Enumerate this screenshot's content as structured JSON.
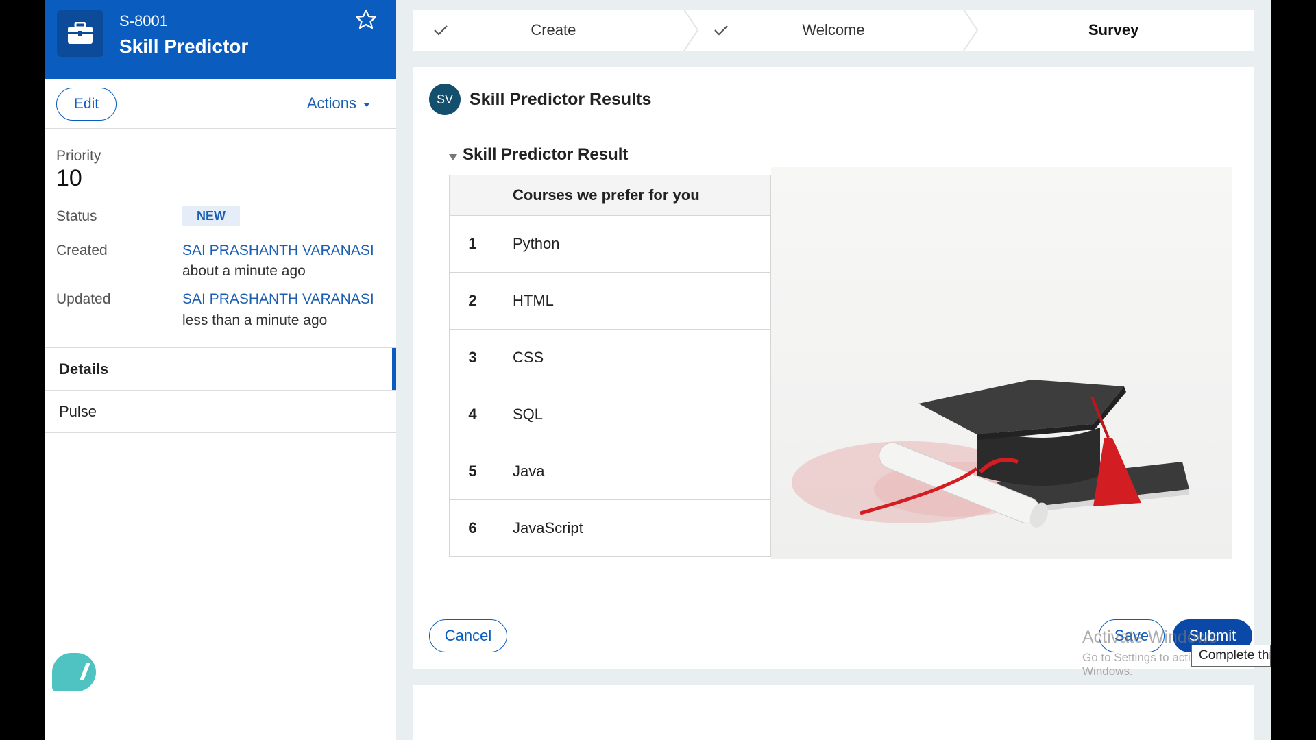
{
  "case": {
    "id": "S-8001",
    "title": "Skill Predictor"
  },
  "toolbar": {
    "edit_label": "Edit",
    "actions_label": "Actions"
  },
  "summary": {
    "priority_label": "Priority",
    "priority_value": "10",
    "status_label": "Status",
    "status_value": "NEW",
    "created_label": "Created",
    "created_by": "SAI PRASHANTH VARANASI",
    "created_when": "about a minute ago",
    "updated_label": "Updated",
    "updated_by": "SAI PRASHANTH VARANASI",
    "updated_when": "less than a minute ago"
  },
  "nav": {
    "details": "Details",
    "pulse": "Pulse"
  },
  "stepper": {
    "steps": [
      {
        "label": "Create",
        "done": true
      },
      {
        "label": "Welcome",
        "done": true
      },
      {
        "label": "Survey",
        "done": false
      }
    ]
  },
  "card": {
    "avatar": "SV",
    "title": "Skill Predictor Results",
    "section_title": "Skill Predictor Result",
    "table_header": "Courses we prefer for you",
    "rows": [
      {
        "num": "1",
        "course": "Python"
      },
      {
        "num": "2",
        "course": "HTML"
      },
      {
        "num": "3",
        "course": "CSS"
      },
      {
        "num": "4",
        "course": "SQL"
      },
      {
        "num": "5",
        "course": "Java"
      },
      {
        "num": "6",
        "course": "JavaScript"
      }
    ]
  },
  "buttons": {
    "cancel": "Cancel",
    "save": "Save",
    "submit": "Submit"
  },
  "overlay": {
    "watermark_title": "Activate Windows",
    "watermark_sub": "Go to Settings to activate Windows.",
    "tooltip": "Complete this assignment"
  },
  "colors": {
    "brand": "#0a5cbf",
    "header": "#0a5cbf",
    "submit": "#0a49a8",
    "avatar": "#14506e",
    "chat": "#4fc3c1"
  }
}
